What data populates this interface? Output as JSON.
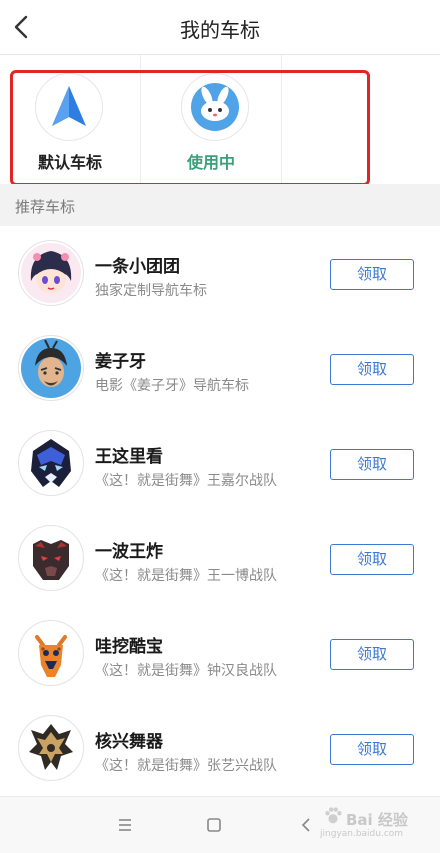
{
  "header": {
    "title": "我的车标"
  },
  "current": {
    "items": [
      {
        "label": "默认车标",
        "icon": "navigation-arrow-icon"
      },
      {
        "label": "使用中",
        "icon": "rabbit-car-icon"
      }
    ]
  },
  "section": {
    "title": "推荐车标"
  },
  "list": {
    "items": [
      {
        "title": "一条小团团",
        "subtitle": "独家定制导航车标",
        "button": "领取",
        "icon": "anime-girl-avatar-icon"
      },
      {
        "title": "姜子牙",
        "subtitle": "电影《姜子牙》导航车标",
        "button": "领取",
        "icon": "jiangziya-avatar-icon"
      },
      {
        "title": "王这里看",
        "subtitle": "《这！就是街舞》王嘉尔战队",
        "button": "领取",
        "icon": "blue-mask-avatar-icon"
      },
      {
        "title": "一波王炸",
        "subtitle": "《这！就是街舞》王一博战队",
        "button": "领取",
        "icon": "panther-avatar-icon"
      },
      {
        "title": "哇挖酷宝",
        "subtitle": "《这！就是街舞》钟汉良战队",
        "button": "领取",
        "icon": "giraffe-avatar-icon"
      },
      {
        "title": "核兴舞器",
        "subtitle": "《这！就是街舞》张艺兴战队",
        "button": "领取",
        "icon": "dragon-crest-avatar-icon"
      }
    ]
  },
  "watermark": {
    "text": "Bai 经验",
    "url": "jingyan.baidu.com"
  },
  "colors": {
    "accent_green": "#3aa07a",
    "button_blue": "#3d79d4",
    "highlight_red": "#e12424"
  }
}
